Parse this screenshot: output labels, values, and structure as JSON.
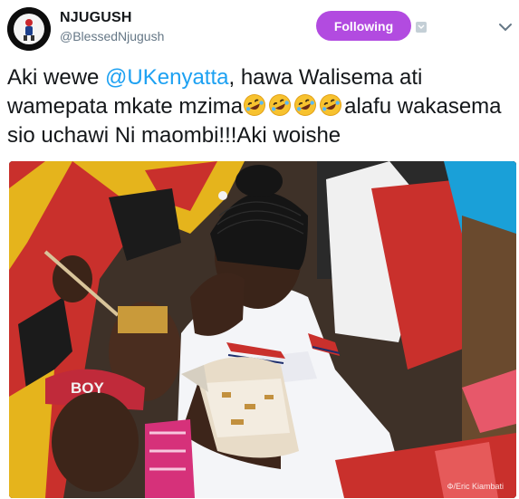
{
  "account": {
    "display_name": "NJUGUSH",
    "handle": "@BlessedNjugush",
    "avatar_icon": "profile-avatar-icon"
  },
  "follow_button": {
    "label": "Following",
    "color": "#b24be0"
  },
  "tweet": {
    "text_part1": "Aki wewe ",
    "mention": "@UKenyatta",
    "text_part2": ", hawa Walisema ati wamepata mkate mzima",
    "emoji_name": "rolling-on-the-floor-laughing-emoji",
    "text_part3": "alafu wakasema sio uchawi Ni maombi!!!Aki woishe"
  },
  "photo": {
    "description_icon": "photo-woman-crying-holding-bread",
    "credit": "Ф/Eric Kiambati",
    "shirt_text": "BOY"
  },
  "colors": {
    "mention": "#1da1f2",
    "name": "#14171a",
    "handle": "#657786"
  }
}
